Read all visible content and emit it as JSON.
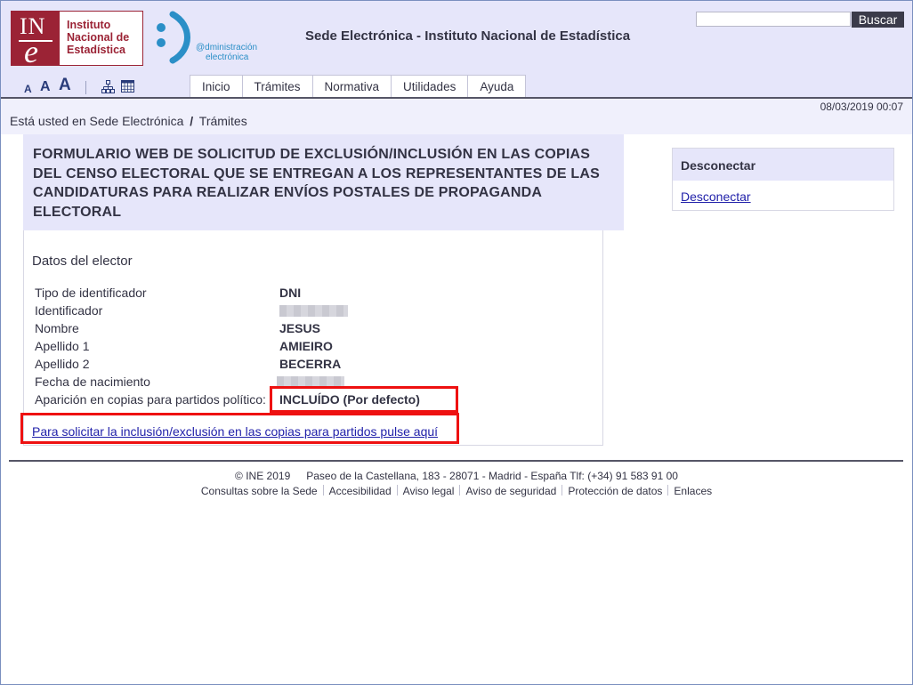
{
  "header": {
    "ine_logo": {
      "mark": "INE",
      "mark_in": "IN",
      "mark_e": "e",
      "text_lines": [
        "Instituto",
        "Nacional de",
        "Estadística"
      ]
    },
    "admin_logo": {
      "line1": "@dministración",
      "line2": "electrónica"
    },
    "site_title": "Sede Electrónica - Instituto Nacional de Estadística",
    "search": {
      "value": "",
      "placeholder": "",
      "button_label": "Buscar"
    },
    "font_sizes": [
      "A",
      "A",
      "A"
    ],
    "icons": [
      "sitemap-icon",
      "calendar-icon"
    ],
    "tabs": [
      {
        "label": "Inicio"
      },
      {
        "label": "Trámites"
      },
      {
        "label": "Normativa"
      },
      {
        "label": "Utilidades"
      },
      {
        "label": "Ayuda"
      }
    ]
  },
  "breadcrumb": {
    "prefix": "Está usted en",
    "items": [
      "Sede Electrónica",
      "Trámites"
    ],
    "separator": "/"
  },
  "datetime": "08/03/2019 00:07",
  "main": {
    "page_title": "FORMULARIO WEB DE SOLICITUD DE EXCLUSIÓN/INCLUSIÓN EN LAS COPIAS DEL CENSO ELECTORAL QUE SE ENTREGAN A LOS REPRESENTANTES DE LAS CANDIDATURAS PARA REALIZAR ENVÍOS POSTALES DE PROPAGANDA ELECTORAL",
    "section_title": "Datos del elector",
    "fields": [
      {
        "label": "Tipo de identificador",
        "value": "DNI"
      },
      {
        "label": "Identificador",
        "value": ""
      },
      {
        "label": "Nombre",
        "value": "JESUS"
      },
      {
        "label": "Apellido 1",
        "value": "AMIEIRO"
      },
      {
        "label": "Apellido 2",
        "value": "BECERRA"
      },
      {
        "label": "Fecha de nacimiento",
        "value": ""
      },
      {
        "label": "Aparición en copias para partidos político:",
        "value": "INCLUÍDO (Por defecto)"
      }
    ],
    "request_link": "Para solicitar la inclusión/exclusión en las copias para partidos pulse aquí",
    "highlight_color": "#ee1111"
  },
  "sidebar": {
    "title": "Desconectar",
    "link": "Desconectar"
  },
  "footer": {
    "copyright": "©  INE 2019",
    "address": "Paseo de la Castellana, 183 - 28071 - Madrid - España Tlf: (+34) 91 583 91 00",
    "links": [
      "Consultas sobre la Sede",
      "Accesibilidad",
      "Aviso legal",
      "Aviso de seguridad",
      "Protección de datos",
      "Enlaces"
    ]
  },
  "colors": {
    "header_bg": "#e6e6fa",
    "brand_red": "#9b2335",
    "admin_blue": "#2b8fc7",
    "link": "#2222aa",
    "text": "#333344"
  }
}
